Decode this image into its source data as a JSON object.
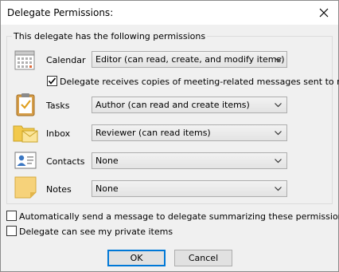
{
  "dialog": {
    "title": "Delegate Permissions:"
  },
  "group": {
    "legend": "This delegate has the following permissions"
  },
  "permissions": [
    {
      "label": "Calendar",
      "icon": "calendar-icon",
      "value": "Editor (can read, create, and modify items)"
    },
    {
      "label": "Tasks",
      "icon": "clipboard-icon",
      "value": "Author (can read and create items)"
    },
    {
      "label": "Inbox",
      "icon": "inbox-folder-icon",
      "value": "Reviewer (can read items)"
    },
    {
      "label": "Contacts",
      "icon": "contact-card-icon",
      "value": "None"
    },
    {
      "label": "Notes",
      "icon": "sticky-note-icon",
      "value": "None"
    }
  ],
  "meeting_copies": {
    "label": "Delegate receives copies of meeting-related messages sent to me",
    "checked": true
  },
  "options": [
    {
      "label": "Automatically send a message to delegate summarizing these permissions",
      "checked": false
    },
    {
      "label": "Delegate can see my private items",
      "checked": false
    }
  ],
  "buttons": {
    "ok": "OK",
    "cancel": "Cancel"
  },
  "colors": {
    "accent": "#0078d7",
    "dialog_bg": "#f0f0f0",
    "titlebar_bg": "#ffffff"
  }
}
